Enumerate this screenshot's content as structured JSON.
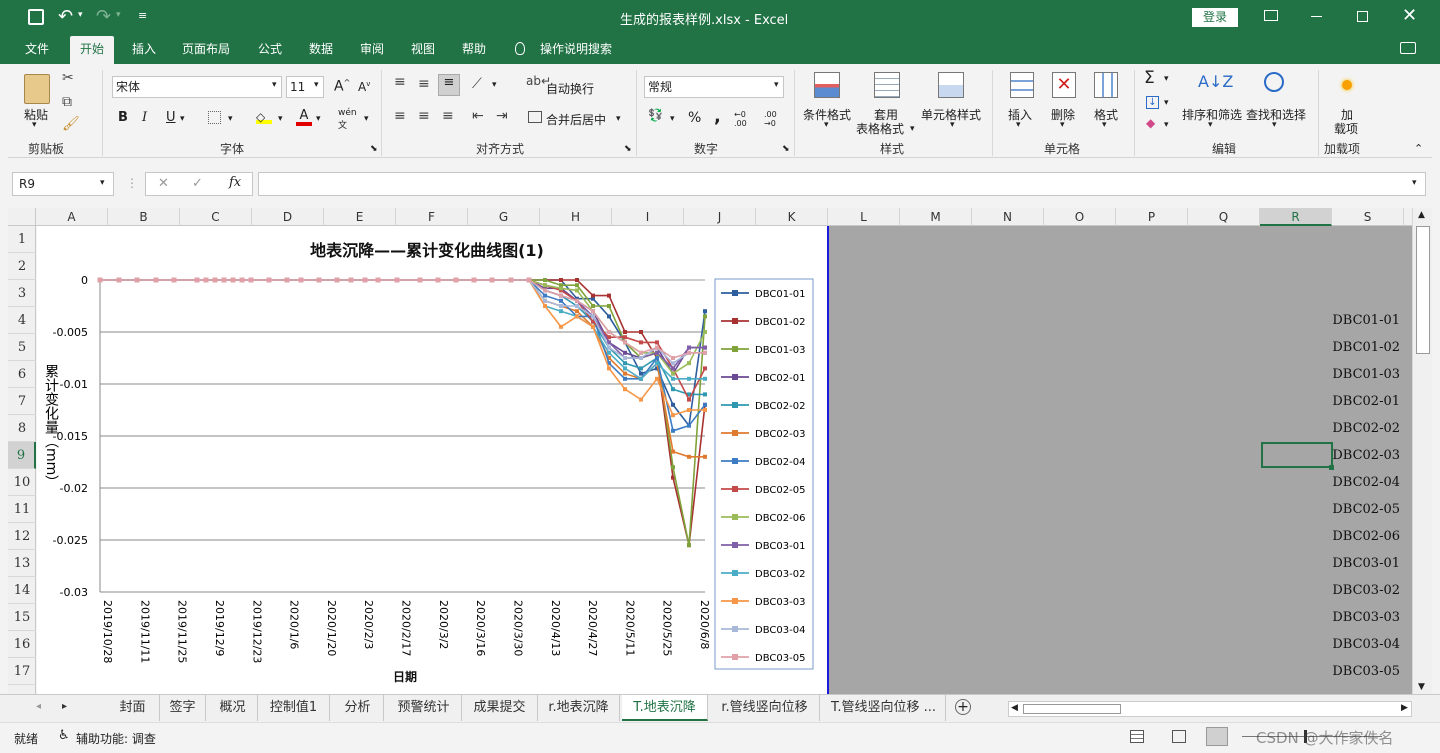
{
  "window": {
    "title": "生成的报表样例.xlsx  -  Excel",
    "login": "登录"
  },
  "ribbon_tabs": [
    "文件",
    "开始",
    "插入",
    "页面布局",
    "公式",
    "数据",
    "审阅",
    "视图",
    "帮助",
    "操作说明搜索"
  ],
  "ribbon": {
    "paste": "粘贴",
    "clipboard": "剪贴板",
    "font_name": "宋体",
    "font_size": "11",
    "font_group": "字体",
    "align_group": "对齐方式",
    "wrap": "自动换行",
    "merge": "合并后居中",
    "number_format": "常规",
    "number_group": "数字",
    "cond_format": "条件格式",
    "table_fmt_1": "套用",
    "table_fmt_2": "表格格式",
    "cell_styles": "单元格样式",
    "styles_group": "样式",
    "insert": "插入",
    "delete": "删除",
    "format": "格式",
    "cells_group": "单元格",
    "sort": "排序和筛选",
    "find": "查找和选择",
    "edit_group": "编辑",
    "addin_1": "加",
    "addin_2": "载项",
    "addins_group": "加载项",
    "bold": "B",
    "italic": "I",
    "underline": "U",
    "percent": "%",
    "comma": ","
  },
  "namebox": "R9",
  "columns": [
    "A",
    "B",
    "C",
    "D",
    "E",
    "F",
    "G",
    "H",
    "I",
    "J",
    "K",
    "L",
    "M",
    "N",
    "O",
    "P",
    "Q",
    "R",
    "S"
  ],
  "rows": [
    "1",
    "2",
    "3",
    "4",
    "5",
    "6",
    "7",
    "8",
    "9",
    "10",
    "11",
    "12",
    "13",
    "14",
    "15",
    "16",
    "17"
  ],
  "cells_R": [
    "DBC01-01",
    "DBC01-02",
    "DBC01-03",
    "DBC02-01",
    "DBC02-02",
    "DBC02-03",
    "DBC02-04",
    "DBC02-05",
    "DBC02-06",
    "DBC03-01",
    "DBC03-02",
    "DBC03-03",
    "DBC03-04",
    "DBC03-05"
  ],
  "sheet_tabs": [
    "封面",
    "签字",
    "概况",
    "控制值1",
    "分析",
    "预警统计",
    "成果提交",
    "r.地表沉降",
    "T.地表沉降",
    "r.管线竖向位移",
    "T.管线竖向位移 ..."
  ],
  "status": {
    "ready": "就绪",
    "accessibility": "辅助功能: 调查",
    "watermark": "CSDN @大作家佚名"
  },
  "chart_data": {
    "type": "line",
    "title": "地表沉降——累计变化曲线图(1)",
    "xlabel": "日期",
    "ylabel": "累计变化量（mm）",
    "ylim": [
      -0.03,
      0
    ],
    "y_ticks": [
      "0",
      "-0.005",
      "-0.01",
      "-0.015",
      "-0.02",
      "-0.025",
      "-0.03"
    ],
    "x_ticks": [
      "2019/10/28",
      "2019/11/11",
      "2019/11/25",
      "2019/12/9",
      "2019/12/23",
      "2020/1/6",
      "2020/1/20",
      "2020/2/3",
      "2020/2/17",
      "2020/3/2",
      "2020/3/16",
      "2020/3/30",
      "2020/4/13",
      "2020/4/27",
      "2020/5/11",
      "2020/5/25",
      "2020/6/8"
    ],
    "legend_position": "right",
    "series": [
      {
        "name": "DBC01-01",
        "color": "#2e5e9e",
        "values": [
          0,
          0,
          0,
          -0.0018,
          -0.0018,
          -0.0035,
          -0.006,
          -0.009,
          -0.0085,
          -0.012,
          -0.014,
          -0.003
        ]
      },
      {
        "name": "DBC01-02",
        "color": "#a83232",
        "values": [
          0,
          0,
          0,
          0,
          -0.0015,
          -0.0015,
          -0.005,
          -0.005,
          -0.0075,
          -0.019,
          -0.0255,
          -0.012
        ]
      },
      {
        "name": "DBC01-03",
        "color": "#7fa33a",
        "values": [
          0,
          0,
          -0.0005,
          -0.0005,
          -0.0025,
          -0.0025,
          -0.006,
          -0.0075,
          -0.007,
          -0.018,
          -0.0255,
          -0.0035
        ]
      },
      {
        "name": "DBC02-01",
        "color": "#6b4a94",
        "values": [
          0,
          -0.0008,
          -0.0008,
          -0.002,
          -0.003,
          -0.006,
          -0.007,
          -0.0075,
          -0.0065,
          -0.009,
          -0.0065,
          -0.0065
        ]
      },
      {
        "name": "DBC02-02",
        "color": "#2f98b0",
        "values": [
          0,
          -0.001,
          -0.0015,
          -0.0025,
          -0.004,
          -0.0065,
          -0.008,
          -0.0085,
          -0.0075,
          -0.0105,
          -0.011,
          -0.011
        ]
      },
      {
        "name": "DBC02-03",
        "color": "#e07a2e",
        "values": [
          0,
          -0.002,
          -0.0025,
          -0.003,
          -0.0045,
          -0.0075,
          -0.009,
          -0.0095,
          -0.008,
          -0.0165,
          -0.017,
          -0.017
        ]
      },
      {
        "name": "DBC02-04",
        "color": "#3c7cc4",
        "values": [
          0,
          -0.0015,
          -0.002,
          -0.0035,
          -0.0035,
          -0.008,
          -0.0095,
          -0.0095,
          -0.0075,
          -0.0145,
          -0.014,
          -0.012
        ]
      },
      {
        "name": "DBC02-05",
        "color": "#c44a4a",
        "values": [
          0,
          -0.0005,
          -0.001,
          -0.002,
          -0.004,
          -0.0055,
          -0.0055,
          -0.006,
          -0.006,
          -0.0085,
          -0.0115,
          -0.0085
        ]
      },
      {
        "name": "DBC02-06",
        "color": "#9bbb59",
        "values": [
          0,
          -0.0005,
          -0.0008,
          -0.001,
          -0.003,
          -0.005,
          -0.006,
          -0.007,
          -0.007,
          -0.009,
          -0.008,
          -0.005
        ]
      },
      {
        "name": "DBC03-01",
        "color": "#7f5fa8",
        "values": [
          0,
          -0.001,
          -0.0015,
          -0.002,
          -0.0035,
          -0.006,
          -0.0075,
          -0.0075,
          -0.007,
          -0.0085,
          -0.0065,
          -0.0065
        ]
      },
      {
        "name": "DBC03-02",
        "color": "#4bacc6",
        "values": [
          0,
          -0.0025,
          -0.003,
          -0.0035,
          -0.0045,
          -0.007,
          -0.0085,
          -0.0095,
          -0.008,
          -0.0095,
          -0.0095,
          -0.0095
        ]
      },
      {
        "name": "DBC03-03",
        "color": "#f79646",
        "values": [
          0,
          -0.0025,
          -0.0045,
          -0.0035,
          -0.0045,
          -0.0085,
          -0.0105,
          -0.0115,
          -0.0095,
          -0.013,
          -0.0125,
          -0.0125
        ]
      },
      {
        "name": "DBC03-04",
        "color": "#a9b8d8",
        "values": [
          0,
          -0.002,
          -0.0025,
          -0.0025,
          -0.0035,
          -0.0065,
          -0.0075,
          -0.0075,
          -0.0065,
          -0.008,
          -0.007,
          -0.007
        ]
      },
      {
        "name": "DBC03-05",
        "color": "#e0a0a8",
        "values": [
          0,
          -0.001,
          -0.0015,
          -0.002,
          -0.003,
          -0.005,
          -0.006,
          -0.007,
          -0.0065,
          -0.0075,
          -0.007,
          -0.007
        ]
      }
    ]
  }
}
